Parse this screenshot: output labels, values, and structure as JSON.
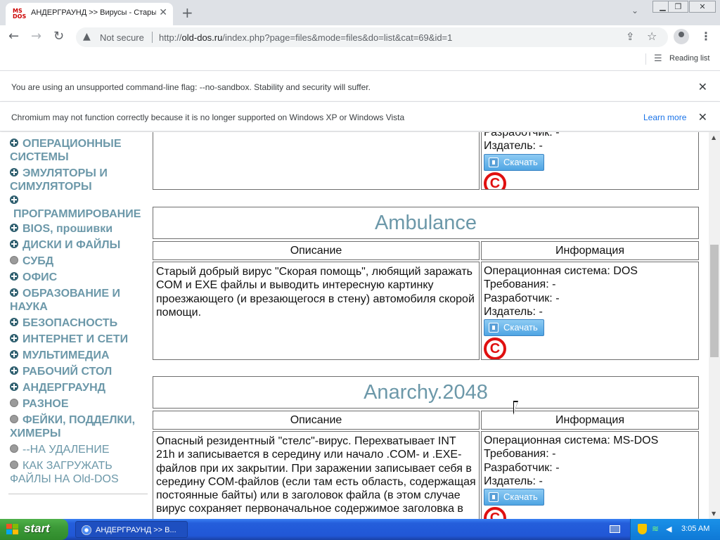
{
  "browser": {
    "tab": {
      "favicon_top": "MS",
      "favicon_bottom": "DOS",
      "title": "АНДЕРГРАУНД >> Вирусы - Стары",
      "close": "✕"
    },
    "new_tab": "+",
    "tab_search": "⌄",
    "window_buttons": {
      "minimize": "▁",
      "maximize": "❐",
      "close": "✕"
    },
    "nav": {
      "back": "←",
      "forward": "→",
      "reload": "↻"
    },
    "omnibox": {
      "warning_icon": "▲",
      "not_secure": "Not secure",
      "url_prefix": "http://",
      "url_host": "old-dos.ru",
      "url_path": "/index.php?page=files&mode=files&do=list&cat=69&id=1"
    },
    "share_icon": "⇪",
    "star_icon": "☆",
    "menu_icon": "⋮",
    "reading_list_icon": "☰",
    "reading_list_label": "Reading list"
  },
  "infobars": [
    {
      "message": "You are using an unsupported command-line flag: --no-sandbox. Stability and security will suffer.",
      "close": "✕"
    },
    {
      "message": "Chromium may not function correctly because it is no longer supported on Windows XP or Windows Vista",
      "link": "Learn more",
      "close": "✕"
    }
  ],
  "sidebar": {
    "categories": [
      {
        "label": "ОПЕРАЦИОННЫЕ СИСТЕМЫ",
        "bullet": "plus"
      },
      {
        "label": "ЭМУЛЯТОРЫ И СИМУЛЯТОРЫ",
        "bullet": "plus"
      },
      {
        "label": "ПРОГРАММИРОВАНИЕ",
        "bullet": "plus"
      },
      {
        "label": "BIOS, прошивки",
        "bullet": "plus"
      },
      {
        "label": "ДИСКИ И ФАЙЛЫ",
        "bullet": "plus"
      },
      {
        "label": "СУБД",
        "bullet": "dot"
      },
      {
        "label": "ОФИС",
        "bullet": "plus"
      },
      {
        "label": "ОБРАЗОВАНИЕ И НАУКА",
        "bullet": "plus"
      },
      {
        "label": "БЕЗОПАСНОСТЬ",
        "bullet": "plus"
      },
      {
        "label": "ИНТЕРНЕТ И СЕТИ",
        "bullet": "plus"
      },
      {
        "label": "МУЛЬТИМЕДИА",
        "bullet": "plus"
      },
      {
        "label": "РАБОЧИЙ СТОЛ",
        "bullet": "plus"
      },
      {
        "label": "АНДЕРГРАУНД",
        "bullet": "plus"
      },
      {
        "label": "РАЗНОЕ",
        "bullet": "dot"
      },
      {
        "label": "ФЕЙКИ, ПОДДЕЛКИ, ХИМЕРЫ",
        "bullet": "dot"
      },
      {
        "label": "--НА УДАЛЕНИЕ",
        "bullet": "dot"
      },
      {
        "label": "КАК ЗАГРУЖАТЬ ФАЙЛЫ НА Old-DOS",
        "bullet": "dot"
      }
    ]
  },
  "files": {
    "headers": {
      "description": "Описание",
      "information": "Информация"
    },
    "download_label": "Скачать",
    "copyright_symbol": "C",
    "partial_top": {
      "info_lines": [
        "Разработчик: -",
        "Издатель: -"
      ]
    },
    "items": [
      {
        "title": "Ambulance",
        "description": "Старый добрый вирус \"Скорая помощь\", любящий заражать COM и EXE файлы и выводить интересную картинку проезжающего (и врезающегося в стену) автомобиля скорой помощи.",
        "info_lines": [
          "Операционная система: DOS",
          "Требования: -",
          "Разработчик: -",
          "Издатель: -"
        ]
      },
      {
        "title": "Anarchy.2048",
        "description": "Опасный резидентный \"стелс\"-вирус. Перехватывает INT 21h и записывается в середину или начало .COM- и .EXE-файлов при их закрытии. При заражении записывает себя в середину COM-файлов (если там есть область, содержащая постоянные байты) или в заголовок файла (в этом случае вирус сохраняет первоначальное содержимое заголовка в",
        "info_lines": [
          "Операционная система: MS-DOS",
          "Требования: -",
          "Разработчик: -",
          "Издатель: -"
        ]
      }
    ]
  },
  "scrollbar": {
    "up": "▲",
    "down": "▼"
  },
  "taskbar": {
    "start_label": "start",
    "task_item_label": "АНДЕРГРАУНД >> В...",
    "net_icon": "≋",
    "volume_icon": "◀",
    "clock": "3:05 AM"
  }
}
